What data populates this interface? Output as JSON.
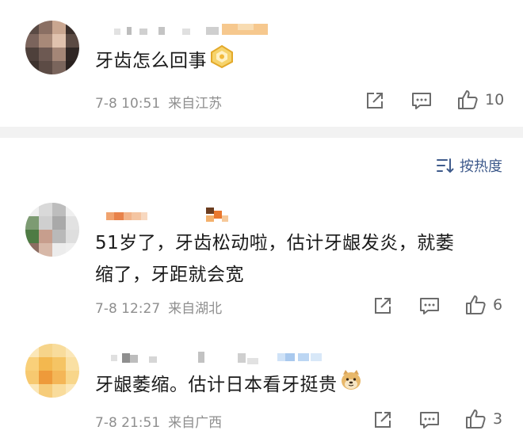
{
  "comments": [
    {
      "text_lines": [
        "牙齿怎么回事"
      ],
      "time": "7-8 10:51",
      "location": "来自江苏",
      "like_count": "10",
      "badge_icon": "gold-crown-badge-icon"
    },
    {
      "text_lines": [
        "51岁了，牙齿松动啦，估计牙龈发炎，就萎",
        "缩了，牙距就会宽"
      ],
      "time": "7-8 12:27",
      "location": "来自湖北",
      "like_count": "6"
    },
    {
      "text_lines": [
        "牙龈萎缩。估计日本看牙挺贵"
      ],
      "time": "7-8 21:51",
      "location": "来自广西",
      "like_count": "3",
      "emoji": "doge-emoji-icon"
    }
  ],
  "sort": {
    "label": "按热度",
    "icon": "sort-lines-icon"
  },
  "colors": {
    "text": "#1a1a1a",
    "meta": "#8f8f8f",
    "link": "#3f5b8c",
    "divider": "#f2f2f2",
    "badge_gold": "#f2c23a"
  }
}
